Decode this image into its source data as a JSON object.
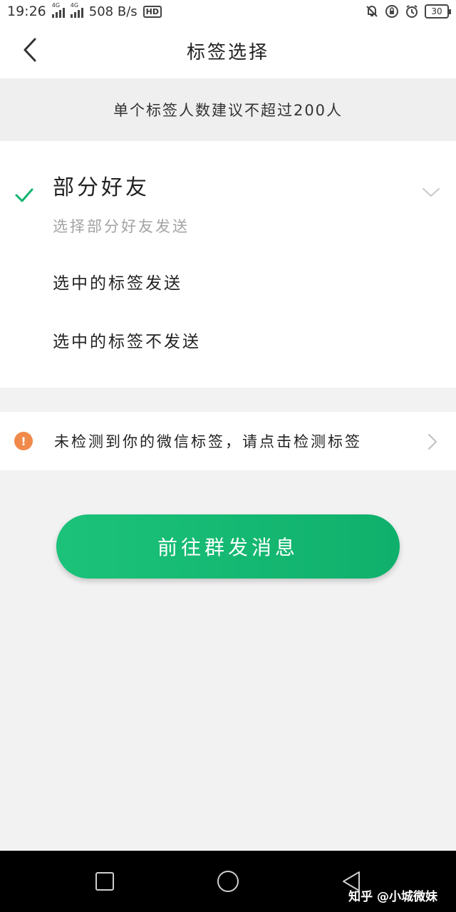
{
  "status_bar": {
    "time": "19:26",
    "network_1": "4G",
    "network_2": "4G",
    "speed": "508 B/s",
    "hd": "HD",
    "battery": "30"
  },
  "header": {
    "title": "标签选择",
    "back_icon": "chevron-left-icon"
  },
  "notice": {
    "text": "单个标签人数建议不超过200人"
  },
  "options": {
    "selected_title": "部分好友",
    "selected_subtitle": "选择部分好友发送",
    "items": [
      {
        "label": "选中的标签发送"
      },
      {
        "label": "选中的标签不发送"
      }
    ]
  },
  "detect": {
    "icon": "!",
    "text": "未检测到你的微信标签，请点击检测标签"
  },
  "primary_button": {
    "label": "前往群发消息"
  },
  "nav_bar": {
    "watermark": "知乎 @小城微妹"
  },
  "colors": {
    "accent": "#12b571",
    "warning": "#f08a4b",
    "background": "#f2f2f2"
  }
}
